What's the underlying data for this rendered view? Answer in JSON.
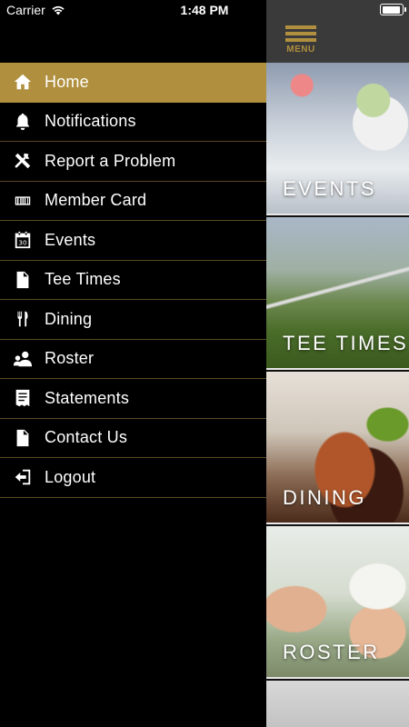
{
  "status_bar": {
    "carrier": "Carrier",
    "time": "1:48 PM"
  },
  "menu_button": {
    "label": "MENU"
  },
  "drawer": {
    "items": [
      {
        "label": "Home",
        "icon": "home-icon",
        "active": true
      },
      {
        "label": "Notifications",
        "icon": "bell-icon"
      },
      {
        "label": "Report a Problem",
        "icon": "tools-icon"
      },
      {
        "label": "Member Card",
        "icon": "barcode-icon"
      },
      {
        "label": "Events",
        "icon": "calendar-icon"
      },
      {
        "label": "Tee Times",
        "icon": "document-icon"
      },
      {
        "label": "Dining",
        "icon": "fork-knife-icon"
      },
      {
        "label": "Roster",
        "icon": "people-icon"
      },
      {
        "label": "Statements",
        "icon": "statement-icon"
      },
      {
        "label": "Contact Us",
        "icon": "document-icon"
      },
      {
        "label": "Logout",
        "icon": "logout-icon"
      }
    ]
  },
  "tiles": [
    {
      "label": "EVENTS"
    },
    {
      "label": "TEE TIMES"
    },
    {
      "label": "DINING"
    },
    {
      "label": "ROSTER"
    }
  ],
  "colors": {
    "accent_gold": "#b08f3e",
    "drawer_bg": "#000000",
    "divider": "#5a4a24",
    "topbar_bg": "#3a3a3a"
  }
}
